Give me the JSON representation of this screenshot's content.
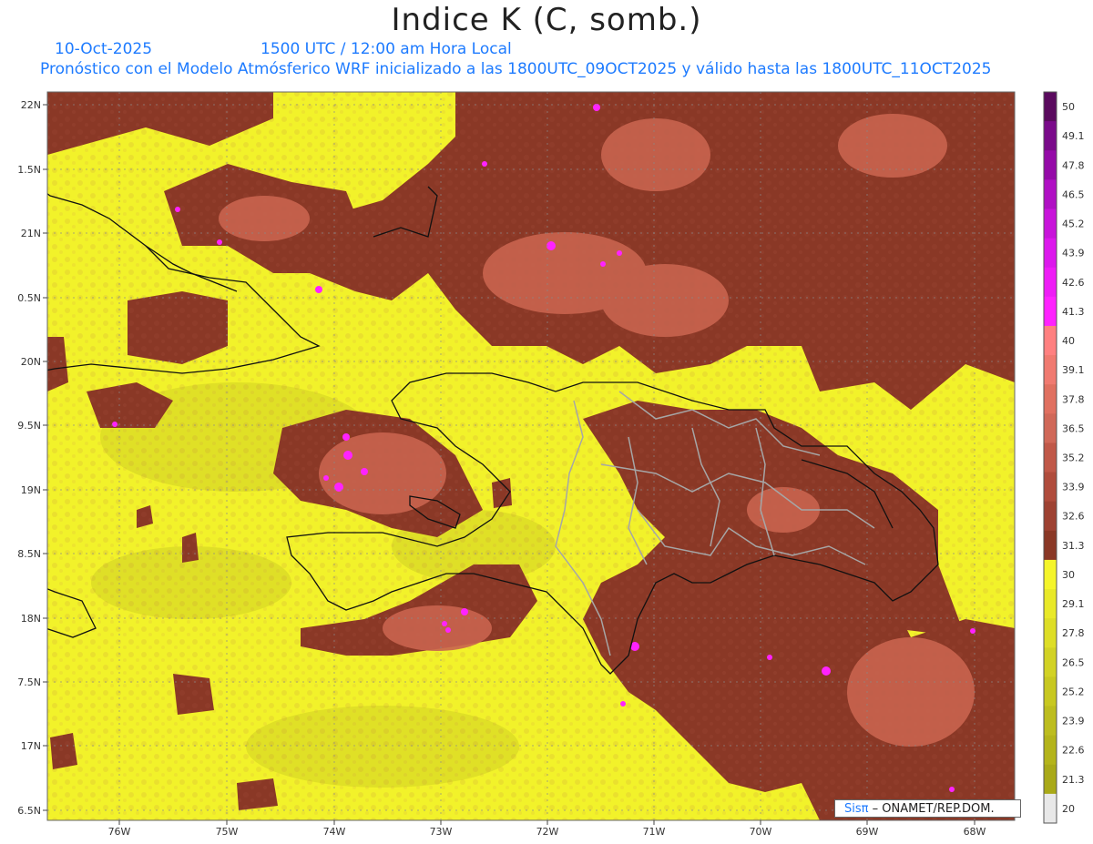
{
  "header": {
    "title": "Indice K (C, somb.)",
    "date": "10-Oct-2025",
    "time": "1500 UTC / 12:00 am Hora Local",
    "forecast_note": "Pronóstico con el Modelo Atmósferico WRF inicializado a las 1800UTC_09OCT2025 y válido hasta las  1800UTC_11OCT2025"
  },
  "axes": {
    "lon_ticks": [
      "76W",
      "75W",
      "74W",
      "73W",
      "72W",
      "71W",
      "70W",
      "69W",
      "68W"
    ],
    "lat_ticks": [
      "22N",
      "1.5N",
      "21N",
      "0.5N",
      "20N",
      "9.5N",
      "19N",
      "8.5N",
      "18N",
      "7.5N",
      "17N",
      "6.5N"
    ]
  },
  "colorbar": {
    "labels": [
      "50",
      "49.1",
      "47.8",
      "46.5",
      "45.2",
      "43.9",
      "42.6",
      "41.3",
      "40",
      "39.1",
      "37.8",
      "36.5",
      "35.2",
      "33.9",
      "32.6",
      "31.3",
      "30",
      "29.1",
      "27.8",
      "26.5",
      "25.2",
      "23.9",
      "22.6",
      "21.3",
      "20"
    ],
    "colors": [
      "#5a0a5e",
      "#7a0a8a",
      "#950aa8",
      "#b010c4",
      "#c814da",
      "#dc18ec",
      "#ee1cf6",
      "#ff22ff",
      "#ff8080",
      "#f07a70",
      "#e07060",
      "#d06858",
      "#c05848",
      "#b04c3c",
      "#9e4232",
      "#8a3826",
      "#f5f52a",
      "#e9e928",
      "#dede26",
      "#d2d224",
      "#c8c820",
      "#bdbd1e",
      "#b4b41a",
      "#a9a918",
      "#e8e8e8"
    ]
  },
  "legend": {
    "colors": {
      "low_k": "#f5f52a",
      "mid_k": "#8a3826",
      "high_k": "#e07060",
      "very_high_k": "#ff22ff",
      "coast_line": "#111111",
      "province_line": "#a6a6a6"
    }
  },
  "credit": {
    "sis": "Sisπ",
    "rest": "– ONAMET/REP.DOM."
  }
}
